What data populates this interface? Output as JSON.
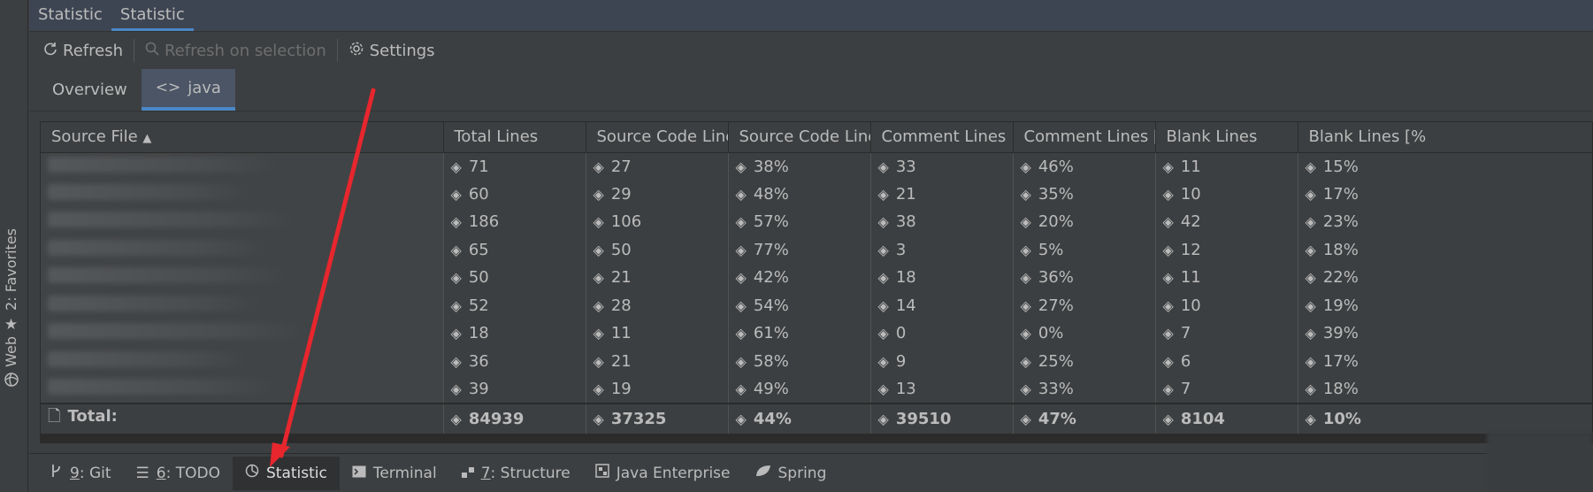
{
  "window_tabs": [
    "Statistic",
    "Statistic"
  ],
  "toolbar": {
    "refresh": "Refresh",
    "refresh_selection": "Refresh on selection",
    "settings": "Settings"
  },
  "subtabs": {
    "overview": "Overview",
    "java": "java"
  },
  "left_strip": {
    "favorites": "2: Favorites",
    "web": "Web"
  },
  "table": {
    "headers": [
      "Source File",
      "Total Lines",
      "Source Code Lines",
      "Source Code Lines ...",
      "Comment Lines",
      "Comment Lines [%]",
      "Blank Lines",
      "Blank Lines [%"
    ],
    "rows": [
      [
        "71",
        "27",
        "38%",
        "33",
        "46%",
        "11",
        "15%"
      ],
      [
        "60",
        "29",
        "48%",
        "21",
        "35%",
        "10",
        "17%"
      ],
      [
        "186",
        "106",
        "57%",
        "38",
        "20%",
        "42",
        "23%"
      ],
      [
        "65",
        "50",
        "77%",
        "3",
        "5%",
        "12",
        "18%"
      ],
      [
        "50",
        "21",
        "42%",
        "18",
        "36%",
        "11",
        "22%"
      ],
      [
        "52",
        "28",
        "54%",
        "14",
        "27%",
        "10",
        "19%"
      ],
      [
        "18",
        "11",
        "61%",
        "0",
        "0%",
        "7",
        "39%"
      ],
      [
        "36",
        "21",
        "58%",
        "9",
        "25%",
        "6",
        "17%"
      ],
      [
        "39",
        "19",
        "49%",
        "13",
        "33%",
        "7",
        "18%"
      ]
    ],
    "total_label": "Total:",
    "totals": [
      "84939",
      "37325",
      "44%",
      "39510",
      "47%",
      "8104",
      "10%"
    ]
  },
  "bottombar": {
    "git_num": "9",
    "git": ": Git",
    "todo_num": "6",
    "todo": ": TODO",
    "statistic": "Statistic",
    "terminal": "Terminal",
    "structure_num": "7",
    "structure": ": Structure",
    "java_enterprise": "Java Enterprise",
    "spring": "Spring"
  },
  "colors": {
    "accent": "#4a88c7",
    "arrow": "#e8262d",
    "bg": "#3c3f41"
  }
}
